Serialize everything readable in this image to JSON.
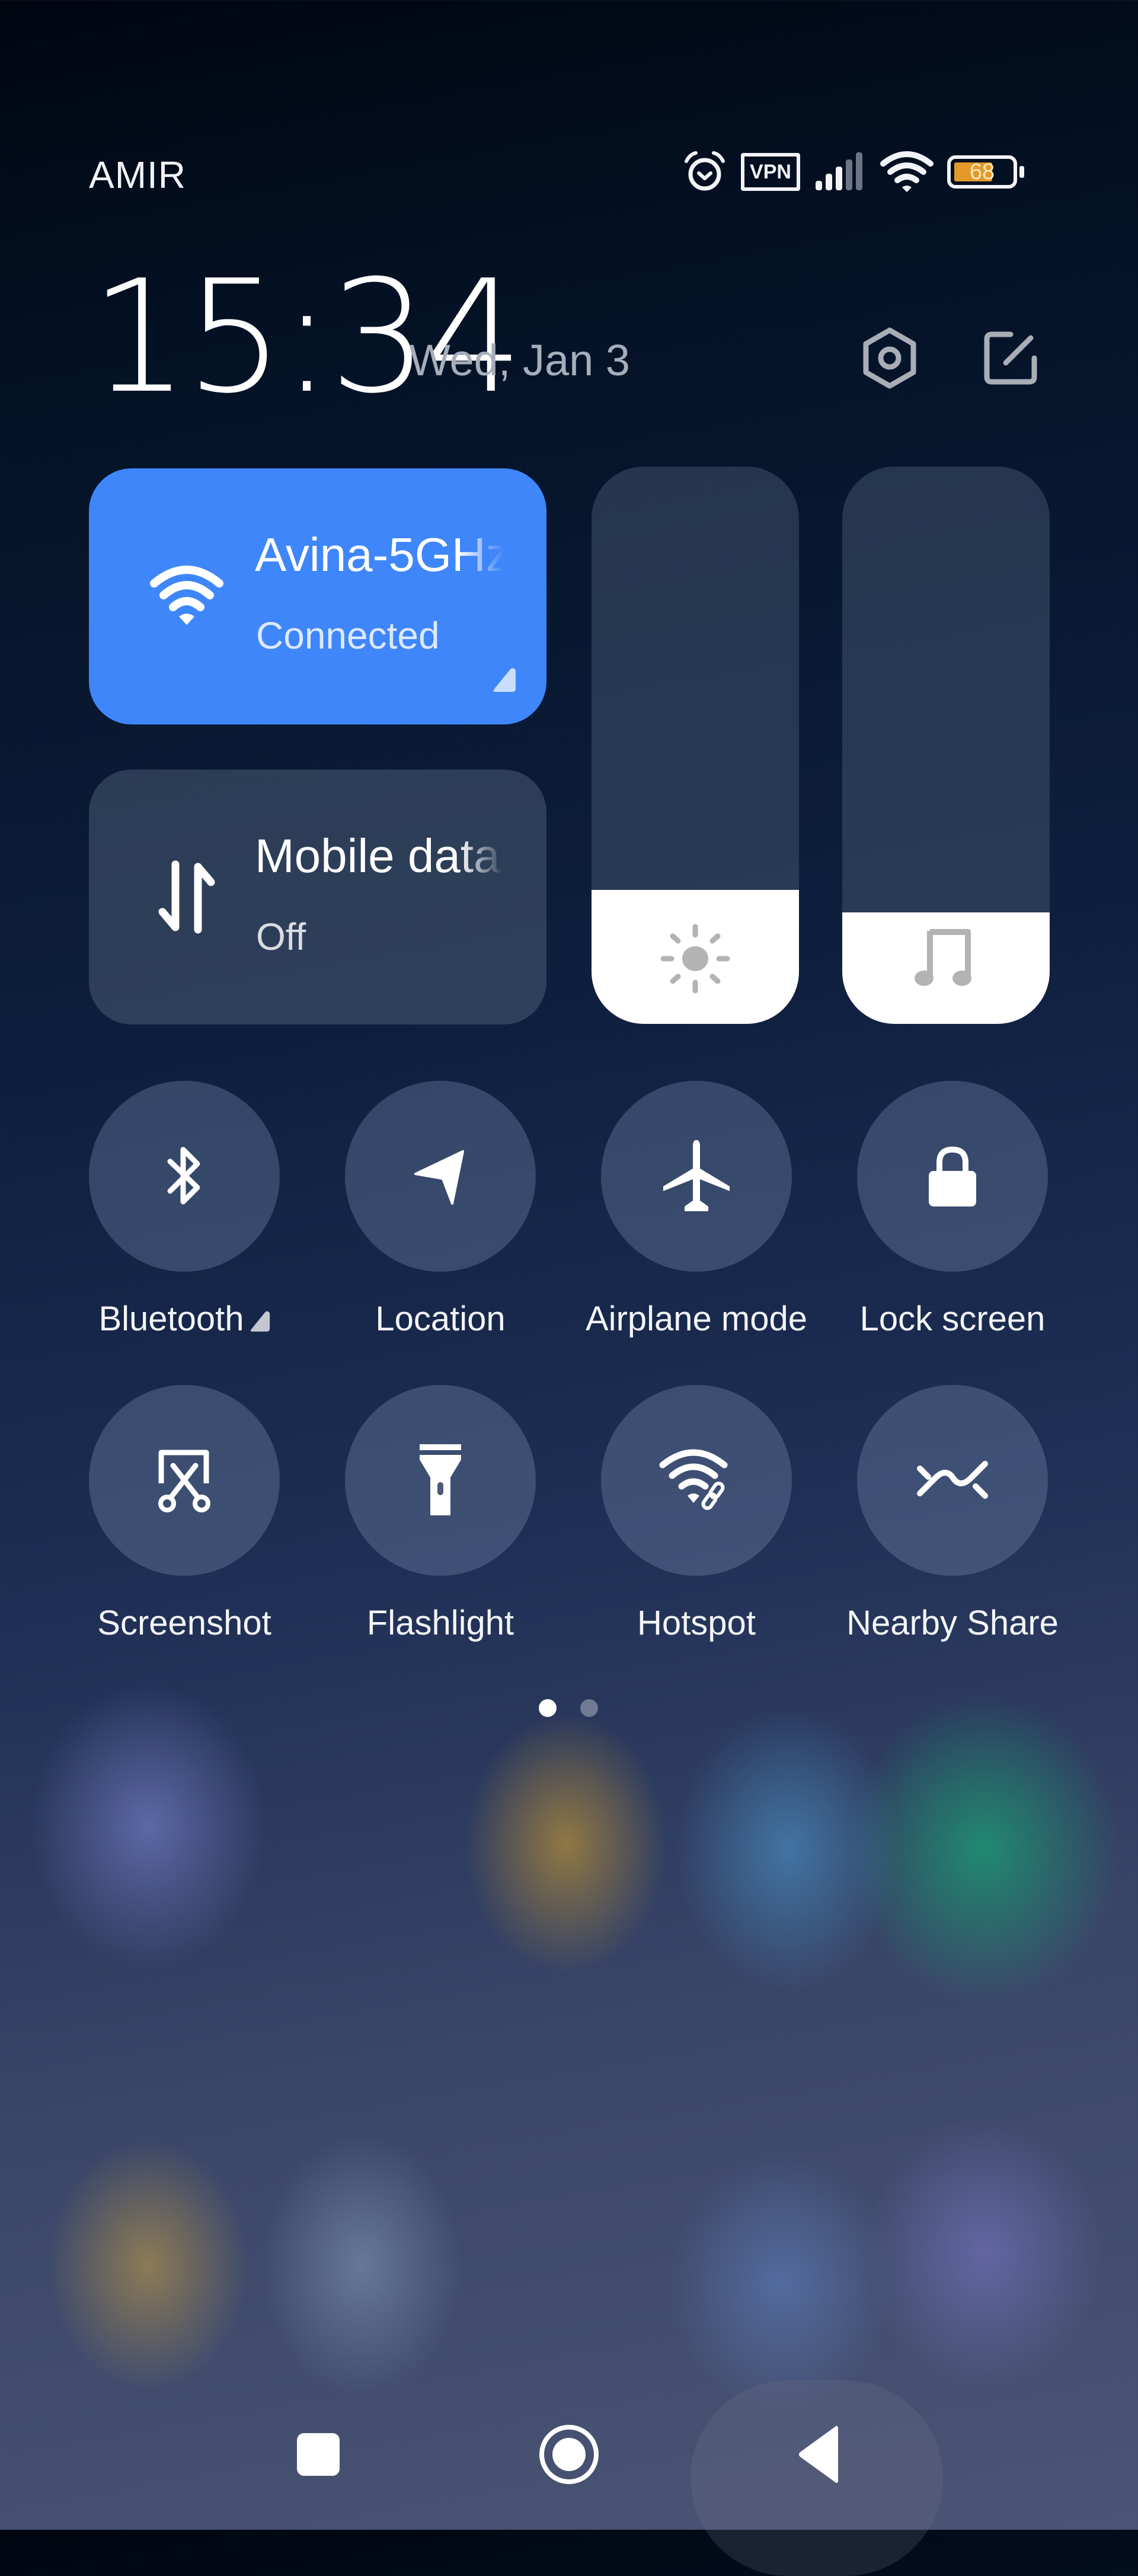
{
  "status_bar": {
    "carrier": "AMIR",
    "icons": [
      "alarm-icon",
      "vpn-icon",
      "signal-icon",
      "wifi-icon",
      "battery-icon"
    ],
    "vpn_label": "VPN",
    "signal_bars_active": 3,
    "signal_bars_total": 5,
    "battery_percent": 68,
    "battery_label": "68",
    "battery_color": "#e39a2a"
  },
  "header": {
    "time": "15:34",
    "date": "Wed, Jan 3",
    "settings_icon": "settings-icon",
    "edit_icon": "edit-icon"
  },
  "tiles": {
    "wifi": {
      "title": "Avina-5GHz",
      "subtitle": "Connected",
      "active": true,
      "color": "#3f86fa",
      "icon": "wifi-icon"
    },
    "mobile_data": {
      "title": "Mobile data",
      "subtitle": "Off",
      "active": false,
      "icon": "mobile-data-icon"
    }
  },
  "sliders": {
    "brightness": {
      "icon": "brightness-icon",
      "level": 0.24
    },
    "volume": {
      "icon": "music-note-icon",
      "level": 0.2
    }
  },
  "toggles": [
    {
      "label": "Bluetooth",
      "icon": "bluetooth-icon",
      "has_more": true
    },
    {
      "label": "Location",
      "icon": "location-icon"
    },
    {
      "label": "Airplane mode",
      "icon": "airplane-icon"
    },
    {
      "label": "Lock screen",
      "icon": "lock-icon"
    },
    {
      "label": "Screenshot",
      "icon": "screenshot-icon"
    },
    {
      "label": "Flashlight",
      "icon": "flashlight-icon"
    },
    {
      "label": "Hotspot",
      "icon": "hotspot-icon"
    },
    {
      "label": "Nearby Share",
      "icon": "nearby-share-icon"
    }
  ],
  "pager": {
    "current_page": 1,
    "total_pages": 2
  },
  "nav_bar": {
    "buttons": [
      "recents-icon",
      "home-icon",
      "back-icon"
    ]
  }
}
